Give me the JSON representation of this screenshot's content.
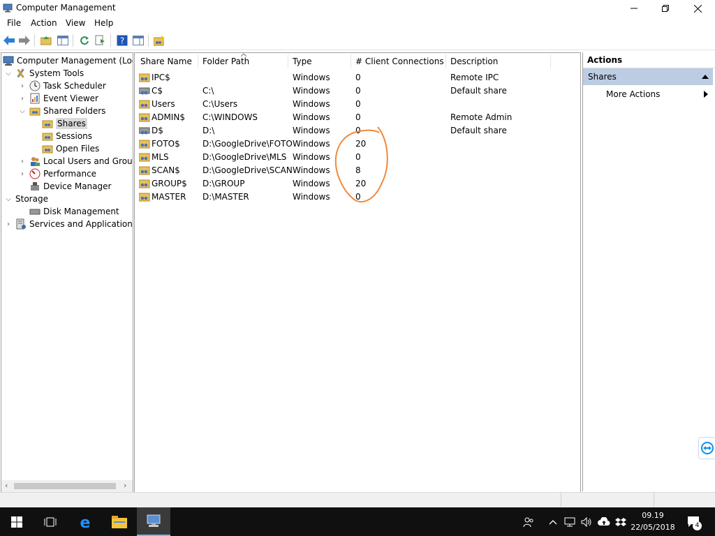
{
  "window": {
    "title": "Computer Management",
    "icon": "computer-management-icon"
  },
  "menu": [
    "File",
    "Action",
    "View",
    "Help"
  ],
  "tree": {
    "root": "Computer Management (Local",
    "system_tools": "System Tools",
    "task_scheduler": "Task Scheduler",
    "event_viewer": "Event Viewer",
    "shared_folders": "Shared Folders",
    "shares": "Shares",
    "sessions": "Sessions",
    "open_files": "Open Files",
    "local_users": "Local Users and Groups",
    "performance": "Performance",
    "device_manager": "Device Manager",
    "storage": "Storage",
    "disk_management": "Disk Management",
    "services": "Services and Applications"
  },
  "table": {
    "columns": [
      "Share Name",
      "Folder Path",
      "Type",
      "# Client Connections",
      "Description"
    ],
    "rows": [
      {
        "name": "IPC$",
        "path": "",
        "type": "Windows",
        "connections": "0",
        "description": "Remote IPC"
      },
      {
        "name": "C$",
        "path": "C:\\",
        "type": "Windows",
        "connections": "0",
        "description": "Default share"
      },
      {
        "name": "Users",
        "path": "C:\\Users",
        "type": "Windows",
        "connections": "0",
        "description": ""
      },
      {
        "name": "ADMIN$",
        "path": "C:\\WINDOWS",
        "type": "Windows",
        "connections": "0",
        "description": "Remote Admin"
      },
      {
        "name": "D$",
        "path": "D:\\",
        "type": "Windows",
        "connections": "0",
        "description": "Default share"
      },
      {
        "name": "FOTO$",
        "path": "D:\\GoogleDrive\\FOTO",
        "type": "Windows",
        "connections": "20",
        "description": ""
      },
      {
        "name": "MLS",
        "path": "D:\\GoogleDrive\\MLS",
        "type": "Windows",
        "connections": "0",
        "description": ""
      },
      {
        "name": "SCAN$",
        "path": "D:\\GoogleDrive\\SCAN",
        "type": "Windows",
        "connections": "8",
        "description": ""
      },
      {
        "name": "GROUP$",
        "path": "D:\\GROUP",
        "type": "Windows",
        "connections": "20",
        "description": ""
      },
      {
        "name": "MASTER",
        "path": "D:\\MASTER",
        "type": "Windows",
        "connections": "0",
        "description": ""
      }
    ]
  },
  "actions": {
    "header": "Actions",
    "section": "Shares",
    "more": "More Actions"
  },
  "taskbar": {
    "time": "09.19",
    "date": "22/05/2018",
    "notifications": "4"
  },
  "colors": {
    "annotation": "#f0883a",
    "selection": "#d9d9d9",
    "actions_section": "#bccde3",
    "taskbar": "#101010"
  }
}
